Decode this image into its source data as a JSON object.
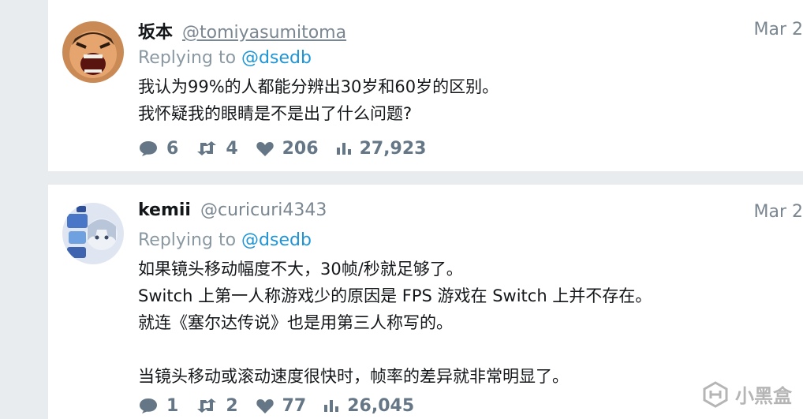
{
  "colors": {
    "background": "#e8ecee",
    "card": "#ffffff",
    "text": "#14171a",
    "muted": "#7a8690",
    "link": "#1f95d6",
    "action": "#657786"
  },
  "replies": [
    {
      "display_name": "坂本",
      "handle": "@tomiyasumitoma",
      "date": "Mar 2",
      "replying_prefix": "Replying to",
      "replying_mention": "@dsedb",
      "lines": [
        "我认为99%的人都能分辨出30岁和60岁的区别。",
        "我怀疑我的眼睛是不是出了什么问题?"
      ],
      "stats": {
        "comments": "6",
        "retweets": "4",
        "likes": "206",
        "views": "27,923"
      }
    },
    {
      "display_name": "kemii",
      "handle": "@curicuri4343",
      "date": "Mar 2",
      "replying_prefix": "Replying to",
      "replying_mention": "@dsedb",
      "lines": [
        "如果镜头移动幅度不大，30帧/秒就足够了。",
        "Switch 上第一人称游戏少的原因是 FPS 游戏在 Switch 上并不存在。",
        "就连《塞尔达传说》也是用第三人称写的。",
        "",
        "当镜头移动或滚动速度很快时，帧率的差异就非常明显了。"
      ],
      "stats": {
        "comments": "1",
        "retweets": "2",
        "likes": "77",
        "views": "26,045"
      }
    }
  ],
  "watermark": {
    "text": "小黑盒"
  }
}
